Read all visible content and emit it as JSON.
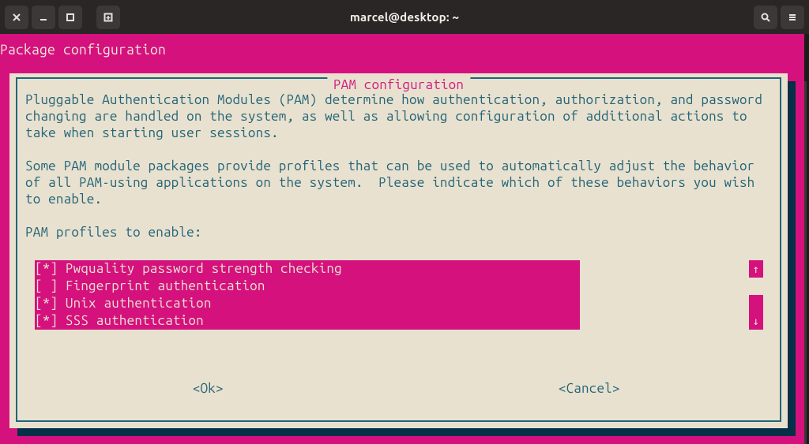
{
  "window": {
    "title": "marcel@desktop: ~"
  },
  "terminal": {
    "header": "Package configuration"
  },
  "dialog": {
    "title": " PAM configuration ",
    "para1": "Pluggable Authentication Modules (PAM) determine how authentication, authorization, and password changing are handled on the system, as well as allowing configuration of additional actions to take when starting user sessions.",
    "para2": "Some PAM module packages provide profiles that can be used to automatically adjust the behavior of all PAM-using applications on the system.  Please indicate which of these behaviors you wish to enable.",
    "prompt": "PAM profiles to enable:",
    "ok": "<Ok>",
    "cancel": "<Cancel>"
  },
  "profiles": [
    {
      "checked": true,
      "label": "Pwquality password strength checking"
    },
    {
      "checked": false,
      "label": "Fingerprint authentication"
    },
    {
      "checked": true,
      "label": "Unix authentication"
    },
    {
      "checked": true,
      "label": "SSS authentication"
    }
  ],
  "marks": {
    "on": "[*] ",
    "off": "[ ] "
  },
  "scroll": {
    "up": "↑",
    "down": "↓"
  }
}
